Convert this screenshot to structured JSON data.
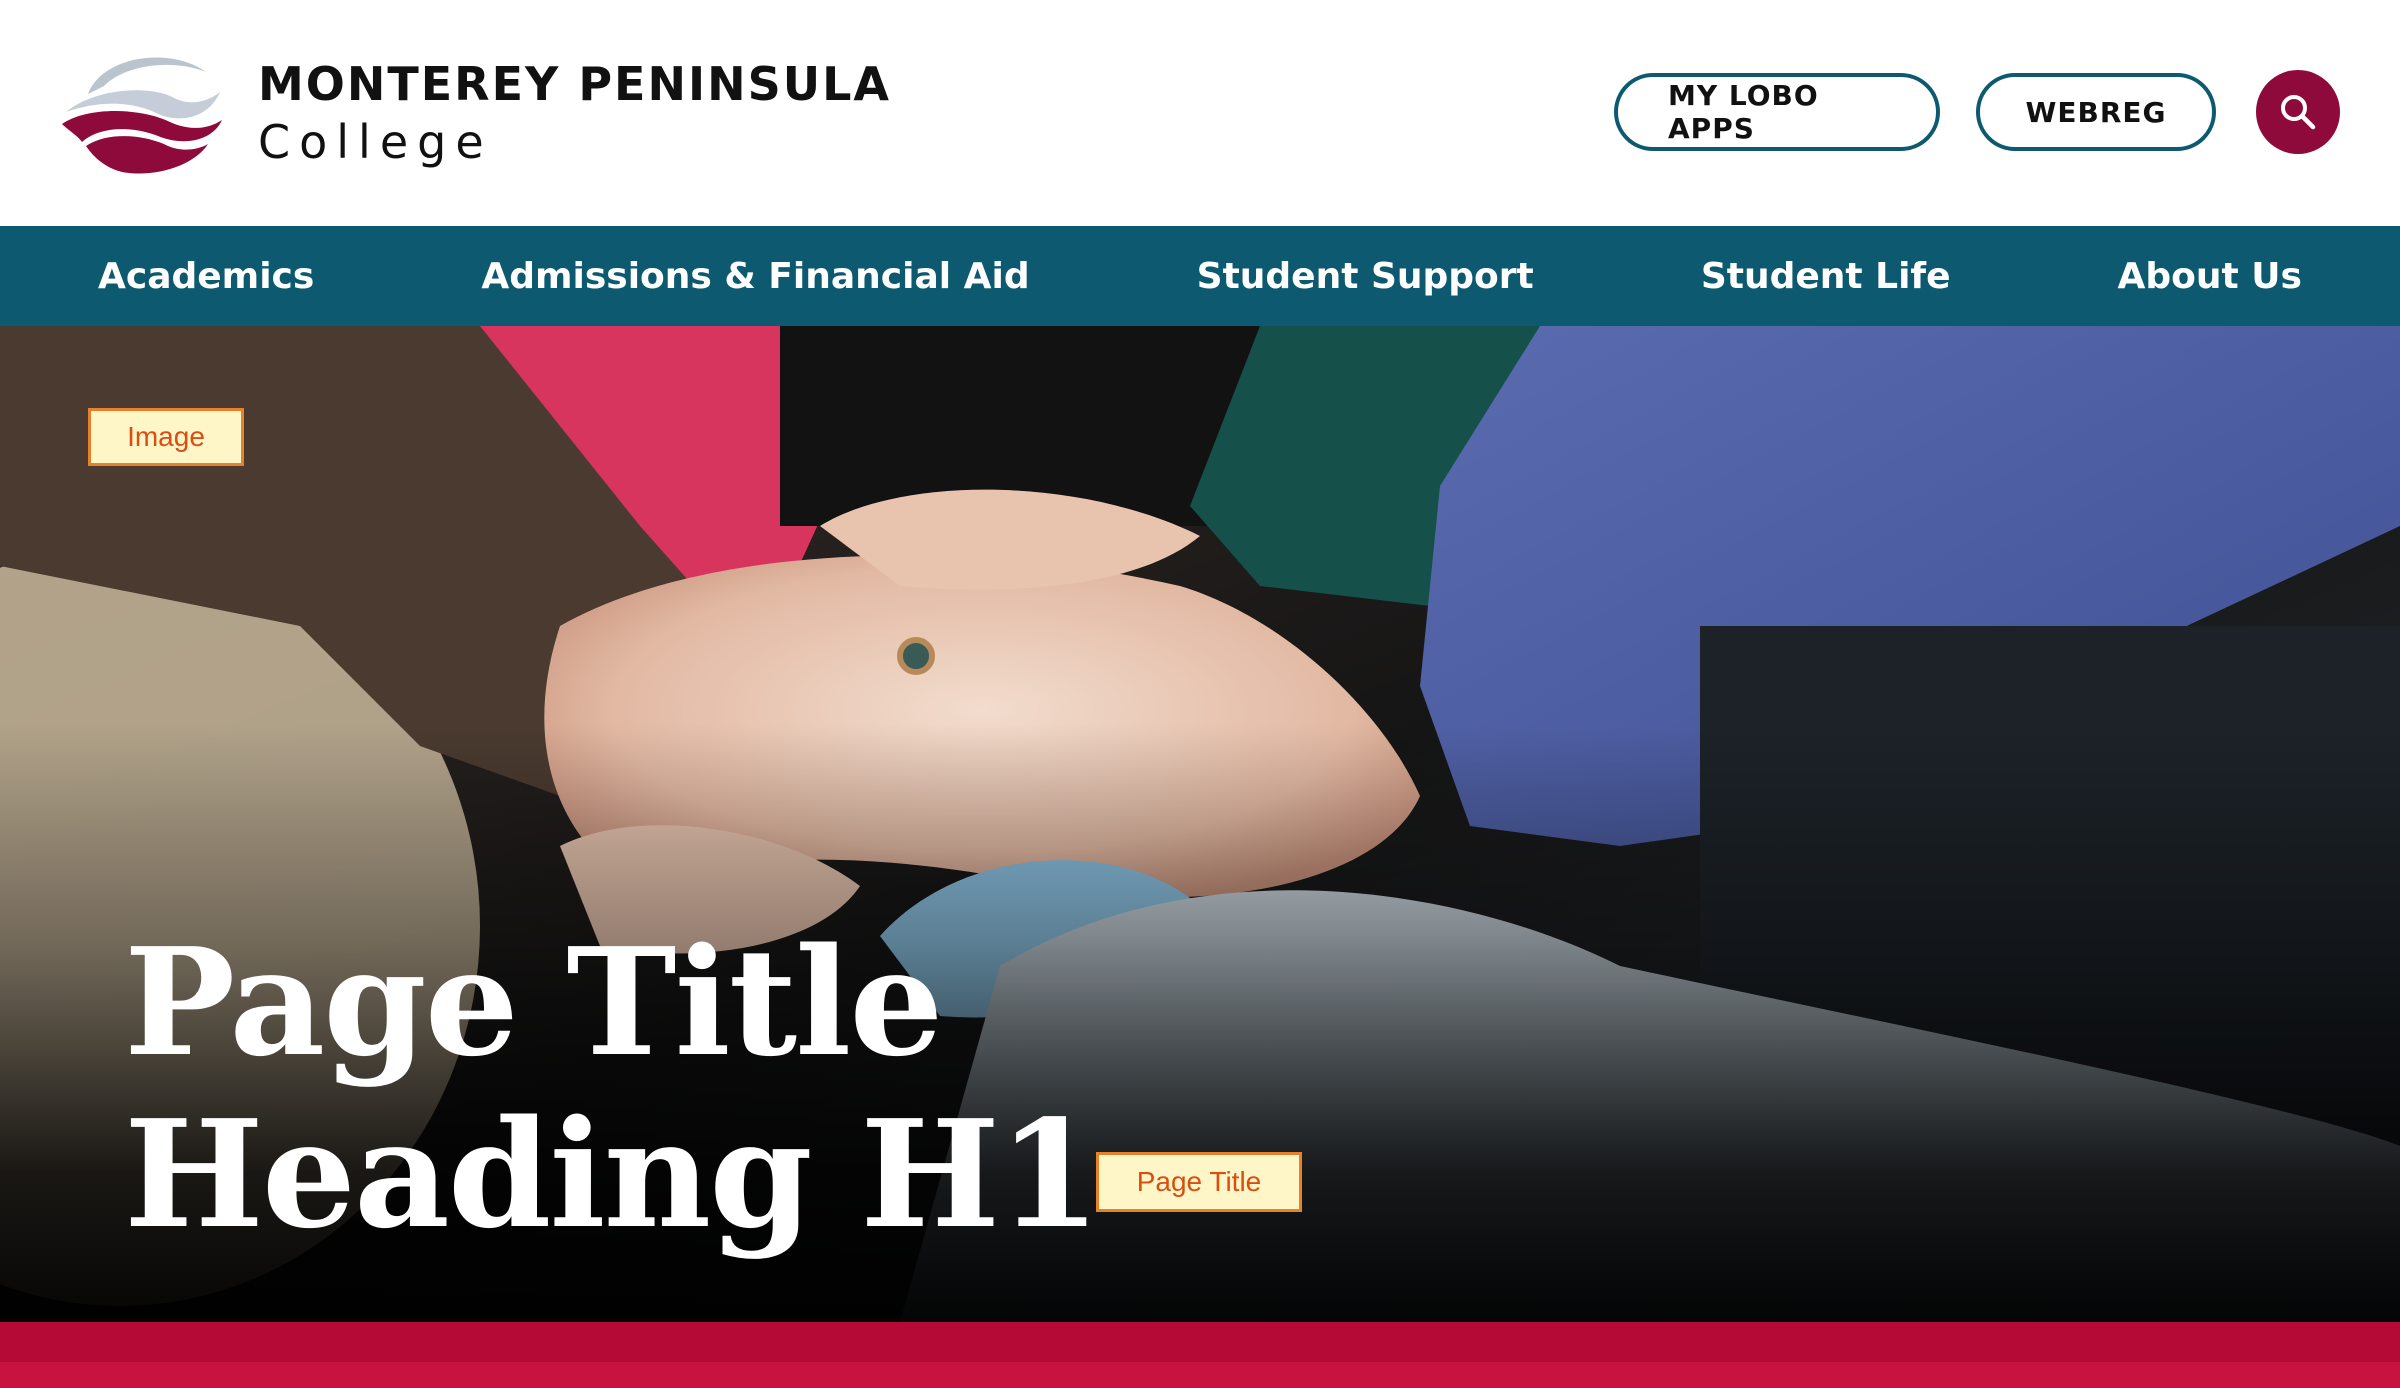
{
  "header": {
    "logo": {
      "line1": "MONTEREY PENINSULA",
      "line2": "College"
    },
    "buttons": {
      "lobo_apps": "MY LOBO APPS",
      "webreg": "WEBREG"
    },
    "search_icon": "search-icon"
  },
  "nav": {
    "items": [
      {
        "label": "Academics"
      },
      {
        "label": "Admissions & Financial Aid"
      },
      {
        "label": "Student Support"
      },
      {
        "label": "Student Life"
      },
      {
        "label": "About Us"
      }
    ]
  },
  "hero": {
    "title_line1": "Page Title",
    "title_line2": "Heading H1",
    "annotations": {
      "image": "Image",
      "page_title": "Page Title"
    }
  },
  "colors": {
    "teal": "#0d5a70",
    "maroon": "#8e0a3a",
    "crimson": "#b50a36"
  }
}
